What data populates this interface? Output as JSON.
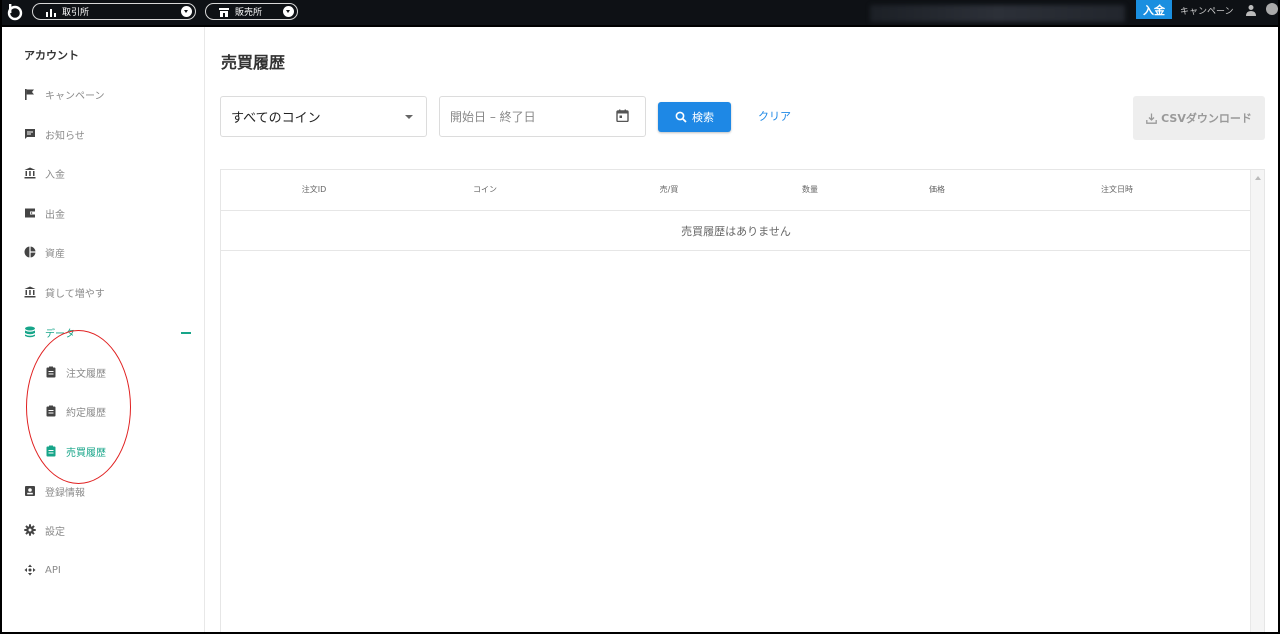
{
  "topbar": {
    "exchange_label": "取引所",
    "store_label": "販売所",
    "deposit_label": "入金",
    "campaign_label": "キャンペーン"
  },
  "sidebar": {
    "title": "アカウント",
    "items": [
      {
        "label": "キャンペーン",
        "icon": "flag-icon"
      },
      {
        "label": "お知らせ",
        "icon": "message-icon"
      },
      {
        "label": "入金",
        "icon": "bank-icon"
      },
      {
        "label": "出金",
        "icon": "wallet-icon"
      },
      {
        "label": "資産",
        "icon": "pie-chart-icon"
      },
      {
        "label": "貸して増やす",
        "icon": "bank-icon"
      },
      {
        "label": "データ",
        "icon": "database-icon"
      },
      {
        "label": "登録情報",
        "icon": "id-card-icon"
      },
      {
        "label": "設定",
        "icon": "gear-icon"
      },
      {
        "label": "API",
        "icon": "api-icon"
      }
    ],
    "data_sub_items": [
      {
        "label": "注文履歴",
        "icon": "clipboard-icon"
      },
      {
        "label": "約定履歴",
        "icon": "clipboard-icon"
      },
      {
        "label": "売買履歴",
        "icon": "clipboard-icon"
      }
    ],
    "collapse_symbol": "−"
  },
  "main": {
    "title": "売買履歴",
    "coin_select_value": "すべてのコイン",
    "date_range_placeholder": "開始日 – 終了日",
    "search_label": "検索",
    "clear_label": "クリア",
    "csv_label": "CSVダウンロード",
    "table": {
      "columns": [
        "注文ID",
        "コイン",
        "売/買",
        "数量",
        "価格",
        "注文日時"
      ],
      "empty_message": "売買履歴はありません"
    }
  },
  "colors": {
    "accent_teal": "#17a589",
    "button_blue": "#1e88e5",
    "topbar_bg": "#0e1115",
    "annotation_red": "#e02020"
  }
}
